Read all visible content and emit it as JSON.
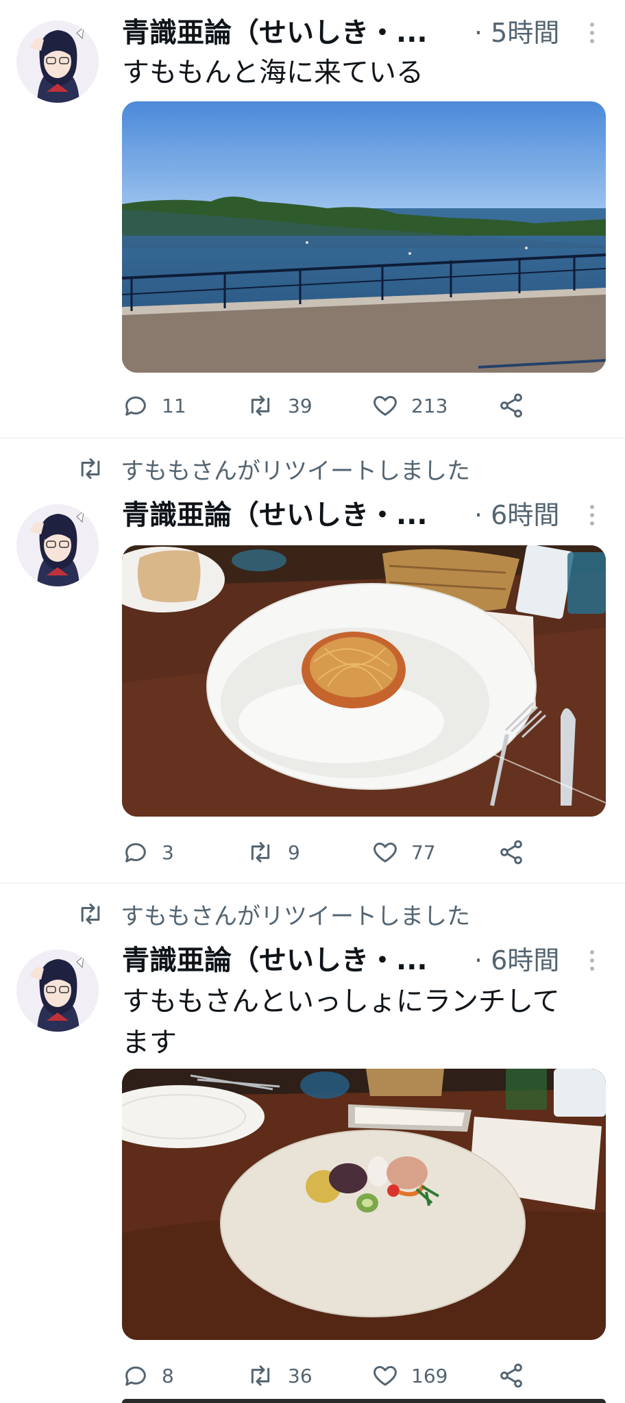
{
  "feed": {
    "tweets": [
      {
        "retweet_context": "",
        "author": "青識亜論（せいしき・...",
        "time": "· 5時間",
        "text": "すももんと海に来ている",
        "replies": "11",
        "retweets": "39",
        "likes": "213"
      },
      {
        "retweet_context": "すももさんがリツイートしました",
        "author": "青識亜論（せいしき・...",
        "time": "· 6時間",
        "text": "",
        "replies": "3",
        "retweets": "9",
        "likes": "77"
      },
      {
        "retweet_context": "すももさんがリツイートしました",
        "author": "青識亜論（せいしき・...",
        "time": "· 6時間",
        "text": "すももさんといっしょにランチして\nます",
        "replies": "8",
        "retweets": "36",
        "likes": "169"
      }
    ]
  },
  "icons": {
    "reply": "reply-icon",
    "retweet": "retweet-icon",
    "like": "heart-icon",
    "share": "share-icon",
    "more": "more-vertical-icon"
  },
  "colors": {
    "text_primary": "#0f1419",
    "text_secondary": "#536471",
    "divider": "#eff3f4"
  }
}
